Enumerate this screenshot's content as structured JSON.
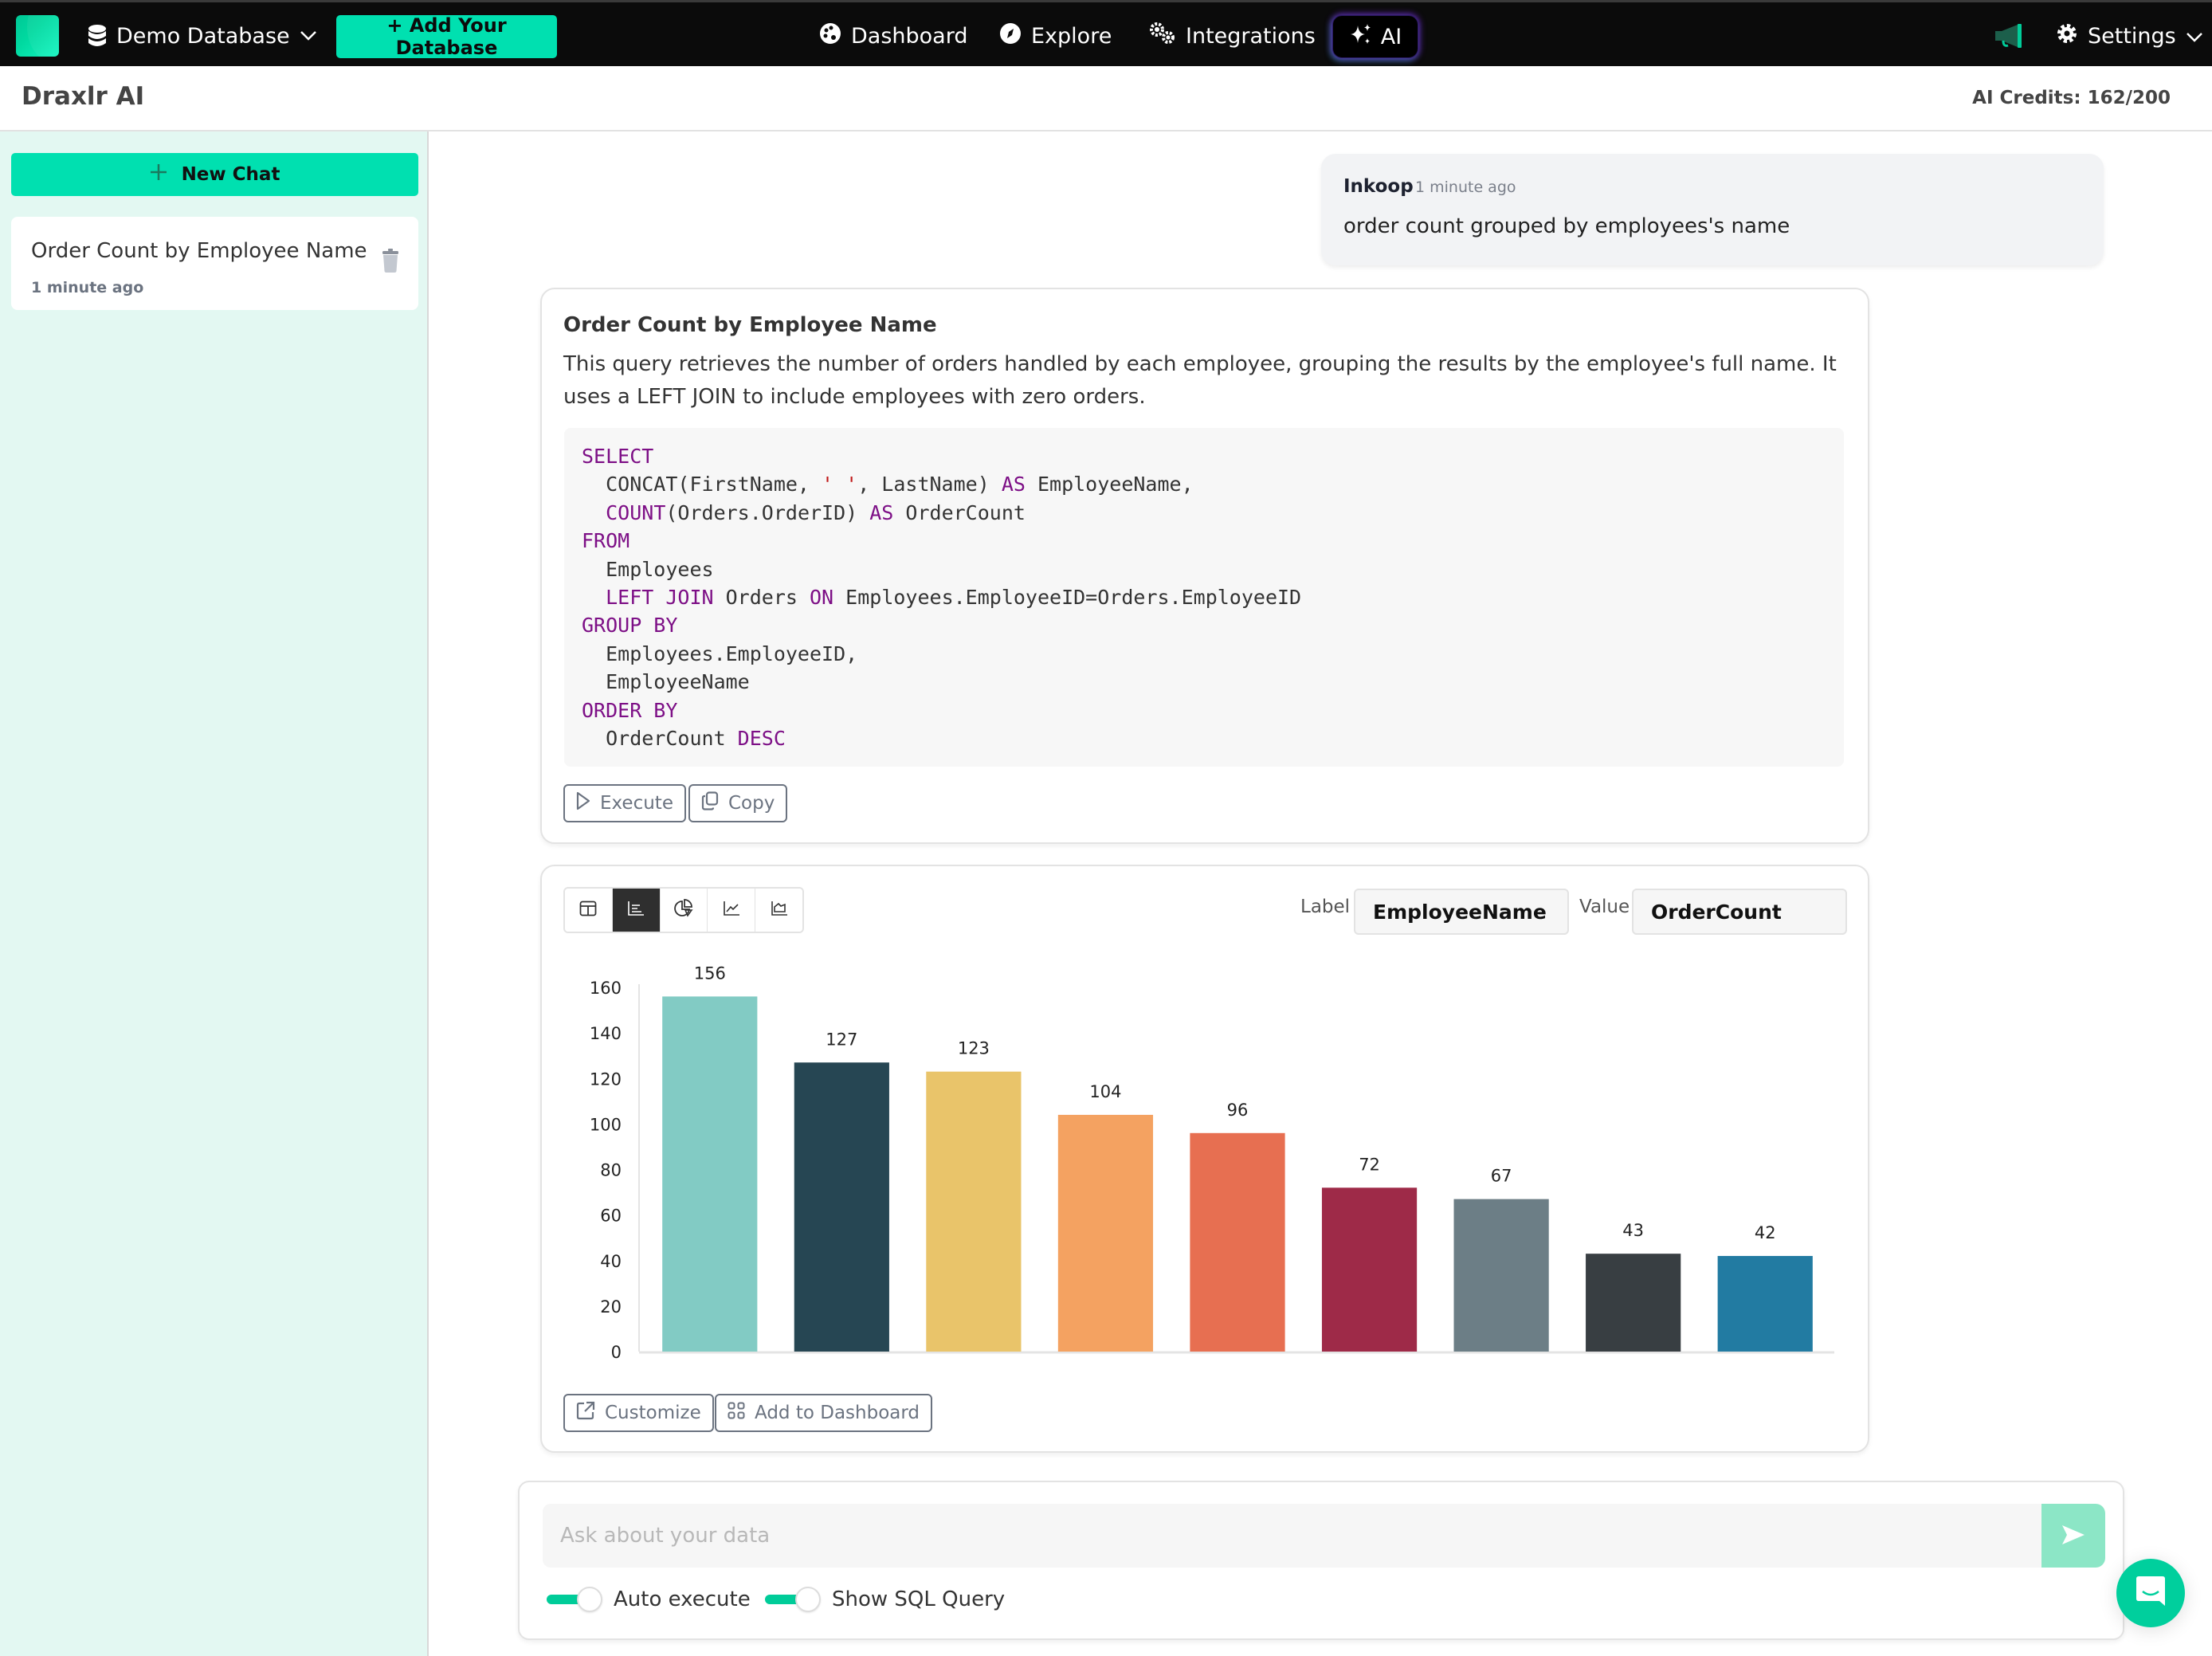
{
  "topnav": {
    "database_selector": "Demo Database",
    "add_database": "+ Add Your Database",
    "items": [
      {
        "label": "Dashboard",
        "icon": "palette-icon"
      },
      {
        "label": "Explore",
        "icon": "compass-icon"
      },
      {
        "label": "Integrations",
        "icon": "gears-icon"
      },
      {
        "label": "AI",
        "icon": "sparkles-icon",
        "active": true
      }
    ],
    "settings": "Settings"
  },
  "header": {
    "title": "Draxlr AI",
    "credits": "AI Credits: 162/200"
  },
  "sidebar": {
    "new_chat": "New Chat",
    "chats": [
      {
        "title": "Order Count by Employee Name",
        "time": "1 minute ago"
      }
    ]
  },
  "conversation": {
    "user_message": {
      "author": "Inkoop",
      "time": "1 minute ago",
      "text": "order count grouped by employees's name"
    },
    "response": {
      "title": "Order Count by Employee Name",
      "description": "This query retrieves the number of orders handled by each employee, grouping the results by the employee's full name. It uses a LEFT JOIN to include employees with zero orders.",
      "sql": [
        [
          {
            "t": "SELECT",
            "k": "kw"
          }
        ],
        [
          {
            "t": "  CONCAT(FirstName, "
          },
          {
            "t": "' '",
            "k": "str"
          },
          {
            "t": ", LastName) "
          },
          {
            "t": "AS",
            "k": "kw"
          },
          {
            "t": " EmployeeName,"
          }
        ],
        [
          {
            "t": "  "
          },
          {
            "t": "COUNT",
            "k": "kw"
          },
          {
            "t": "(Orders.OrderID) "
          },
          {
            "t": "AS",
            "k": "kw"
          },
          {
            "t": " OrderCount"
          }
        ],
        [
          {
            "t": "FROM",
            "k": "kw"
          }
        ],
        [
          {
            "t": "  Employees"
          }
        ],
        [
          {
            "t": "  "
          },
          {
            "t": "LEFT JOIN",
            "k": "kw"
          },
          {
            "t": " Orders "
          },
          {
            "t": "ON",
            "k": "kw"
          },
          {
            "t": " Employees.EmployeeID=Orders.EmployeeID"
          }
        ],
        [
          {
            "t": "GROUP BY",
            "k": "kw"
          }
        ],
        [
          {
            "t": "  Employees.EmployeeID,"
          }
        ],
        [
          {
            "t": "  EmployeeName"
          }
        ],
        [
          {
            "t": "ORDER BY",
            "k": "kw"
          }
        ],
        [
          {
            "t": "  OrderCount "
          },
          {
            "t": "DESC",
            "k": "kw"
          }
        ]
      ],
      "execute_label": "Execute",
      "copy_label": "Copy"
    },
    "visualization": {
      "types": [
        "table",
        "bar",
        "pie",
        "line",
        "area"
      ],
      "active_type": "bar",
      "label_field_label": "Label",
      "label_field_value": "EmployeeName",
      "value_field_label": "Value",
      "value_field_value": "OrderCount",
      "customize_label": "Customize",
      "add_to_dashboard_label": "Add to Dashboard"
    }
  },
  "chart_data": {
    "type": "bar",
    "title": "",
    "xlabel": "",
    "ylabel": "",
    "categories": [
      "",
      "",
      "",
      "",
      "",
      "",
      "",
      "",
      ""
    ],
    "values": [
      156,
      127,
      123,
      104,
      96,
      72,
      67,
      43,
      42
    ],
    "colors": [
      "#82cbc4",
      "#264653",
      "#e9c46a",
      "#f4a261",
      "#e76f51",
      "#9e2a48",
      "#6c7e86",
      "#383e42",
      "#227ba2"
    ],
    "ylim": [
      0,
      160
    ],
    "yticks": [
      0,
      20,
      40,
      60,
      80,
      100,
      120,
      140,
      160
    ],
    "data_labels": true,
    "grid": false,
    "legend": "none"
  },
  "composer": {
    "placeholder": "Ask about your data",
    "value": "",
    "toggles": [
      {
        "label": "Auto execute",
        "on": true
      },
      {
        "label": "Show SQL Query",
        "on": true
      }
    ]
  },
  "colors": {
    "brand": "#00e0b0",
    "nav_bg": "#0b0b0b",
    "sidebar_bg": "#e3f8f2",
    "sql_keyword": "#7d0f86",
    "sql_string": "#c01818"
  }
}
